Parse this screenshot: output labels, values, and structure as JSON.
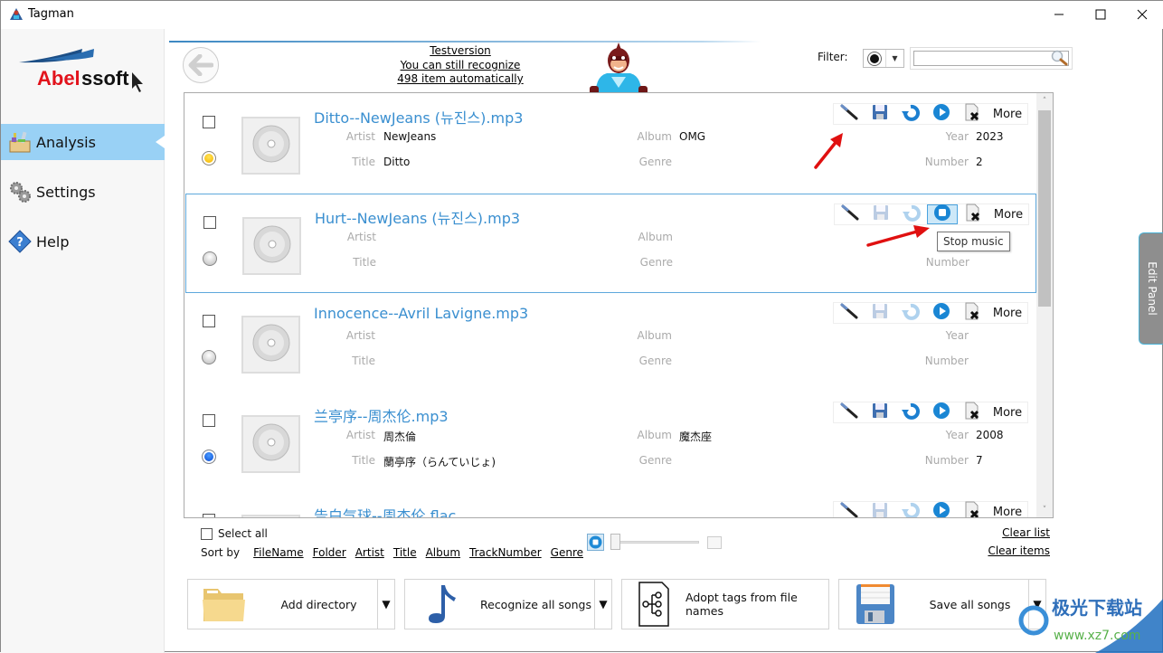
{
  "window": {
    "title": "Tagman",
    "controls": [
      "minimize",
      "maximize",
      "close"
    ]
  },
  "sidebar": {
    "logo_text": "Abelssoft",
    "items": [
      {
        "label": "Analysis",
        "icon": "analysis-toolbox-icon",
        "active": true
      },
      {
        "label": "Settings",
        "icon": "gears-icon",
        "active": false
      },
      {
        "label": "Help",
        "icon": "help-diamond-icon",
        "active": false
      }
    ]
  },
  "header": {
    "trial_lines": [
      "Testversion",
      "You can still recognize",
      "498 item automatically"
    ],
    "filter_label": "Filter:",
    "filter_color": "#111111",
    "filter_value": "",
    "filter_placeholder": ""
  },
  "list": {
    "labels": {
      "artist": "Artist",
      "title": "Title",
      "album": "Album",
      "genre": "Genre",
      "year": "Year",
      "number": "Number"
    },
    "toolbar_more": "More",
    "items": [
      {
        "filename": "Ditto--NewJeans (뉴진스).mp3",
        "artist": "NewJeans",
        "title": "Ditto",
        "album": "OMG",
        "genre": "",
        "year": "2023",
        "number": "2",
        "status": "yellow",
        "checked": false,
        "selected": false,
        "playing": false
      },
      {
        "filename": "Hurt--NewJeans (뉴진스).mp3",
        "artist": "",
        "title": "",
        "album": "",
        "genre": "",
        "year": "",
        "number": "",
        "status": "grey",
        "checked": false,
        "selected": true,
        "playing": true
      },
      {
        "filename": "Innocence--Avril Lavigne.mp3",
        "artist": "",
        "title": "",
        "album": "",
        "genre": "",
        "year": "",
        "number": "",
        "status": "grey",
        "checked": false,
        "selected": false,
        "playing": false
      },
      {
        "filename": "兰亭序--周杰伦.mp3",
        "artist": "周杰倫",
        "title": "蘭亭序（らんていじょ)",
        "album": "魔杰座",
        "genre": "",
        "year": "2008",
        "number": "7",
        "status": "blue",
        "checked": false,
        "selected": false,
        "playing": false
      },
      {
        "filename": "告白气球--周杰伦.flac",
        "artist": "",
        "title": "",
        "album": "",
        "genre": "",
        "year": "",
        "number": "",
        "status": "grey",
        "checked": false,
        "selected": false,
        "playing": false
      }
    ],
    "tooltip": "Stop music"
  },
  "bottom": {
    "select_all": "Select all",
    "sort_by": "Sort by",
    "sort_fields": [
      "FileName",
      "Folder",
      "Artist",
      "Title",
      "Album",
      "TrackNumber",
      "Genre"
    ],
    "volume": 0,
    "clear_list": "Clear list",
    "clear_items": "Clear items",
    "actions": [
      {
        "label": "Add directory",
        "icon": "folder-icon",
        "dropdown": true
      },
      {
        "label": "Recognize all songs",
        "icon": "music-note-icon",
        "dropdown": true
      },
      {
        "label": "Adopt tags from file names",
        "icon": "file-tree-icon",
        "dropdown": false
      },
      {
        "label": "Save all songs",
        "icon": "floppy-disk-icon",
        "dropdown": true
      }
    ]
  },
  "edit_panel": {
    "label": "Edit Panel"
  },
  "watermark": {
    "line1": "极光下载站",
    "line2": "www.xz7.com"
  }
}
